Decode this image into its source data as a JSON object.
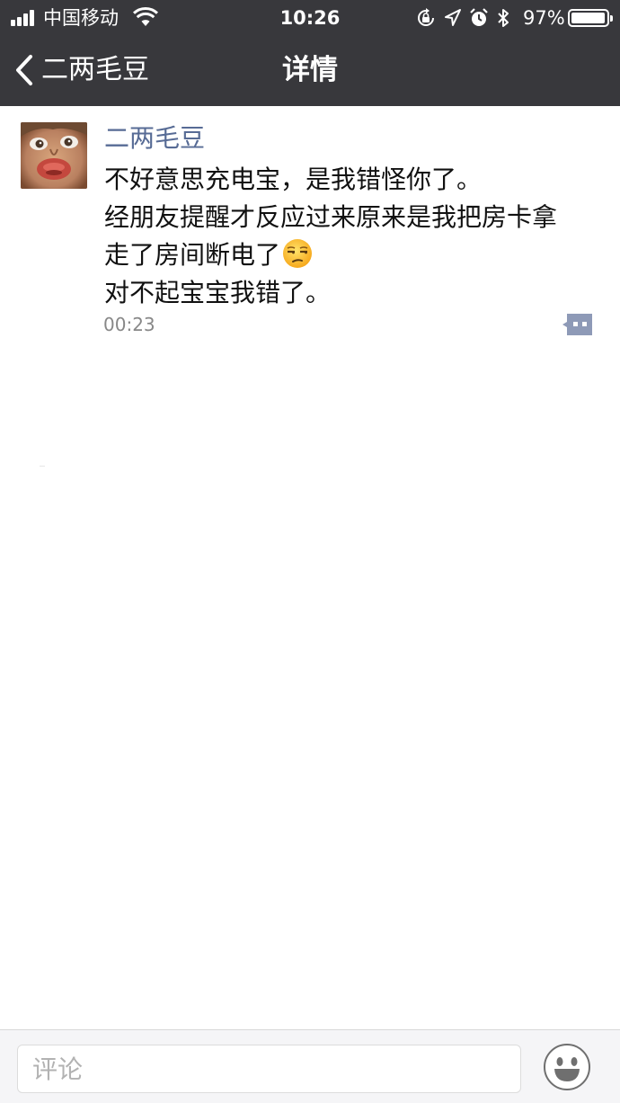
{
  "status_bar": {
    "carrier": "中国移动",
    "time": "10:26",
    "battery_text": "97%",
    "battery_level": 0.97,
    "icons": [
      "signal-icon",
      "wifi-icon",
      "rotation-lock-icon",
      "location-icon",
      "alarm-icon",
      "bluetooth-icon",
      "battery-icon"
    ]
  },
  "nav": {
    "back_label": "二两毛豆",
    "title": "详情"
  },
  "post": {
    "author": "二两毛豆",
    "lines": [
      "不好意思充电宝，是我错怪你了。",
      "经朋友提醒才反应过来原来是我把房卡拿",
      "走了房间断电了",
      "对不起宝宝我错了。"
    ],
    "emoji": "unamused-face-emoji",
    "time": "00:23"
  },
  "comment_bar": {
    "placeholder": "评论",
    "emoji_button": "smiley-icon"
  },
  "colors": {
    "nav_bg": "#38383c",
    "author_link": "#576b95",
    "time_gray": "#888888",
    "comment_icon": "#8e9ab7"
  }
}
